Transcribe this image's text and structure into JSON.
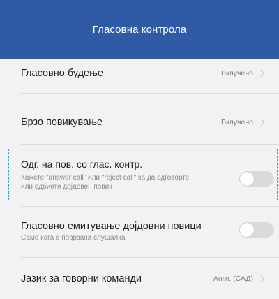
{
  "header": {
    "title": "Гласовна контрола"
  },
  "settings": [
    {
      "title": "Гласовно будење",
      "value": "Вклучено"
    },
    {
      "title": "Брзо повикување",
      "value": "Вклучено"
    },
    {
      "title": "Одг. на пов. со глас. контр.",
      "subtitle_line1": "Кажете \"answer call\" или \"reject call\" за да одговорте",
      "subtitle_line2": "или одбиете дојдовен повик",
      "toggle_on": false
    },
    {
      "title": "Гласовно емитување дојдовни повици",
      "subtitle_line1": "Само кога е поврзана слушалка",
      "toggle_on": false
    },
    {
      "title": "Јазик за говорни команди",
      "value": "Англ. (САД)"
    }
  ],
  "colors": {
    "appbar": "#2f5aa6",
    "highlight_border": "#2ea3b6",
    "toggle_off": "#dadada"
  },
  "icons": {
    "chevron": "chevron-right-icon"
  }
}
